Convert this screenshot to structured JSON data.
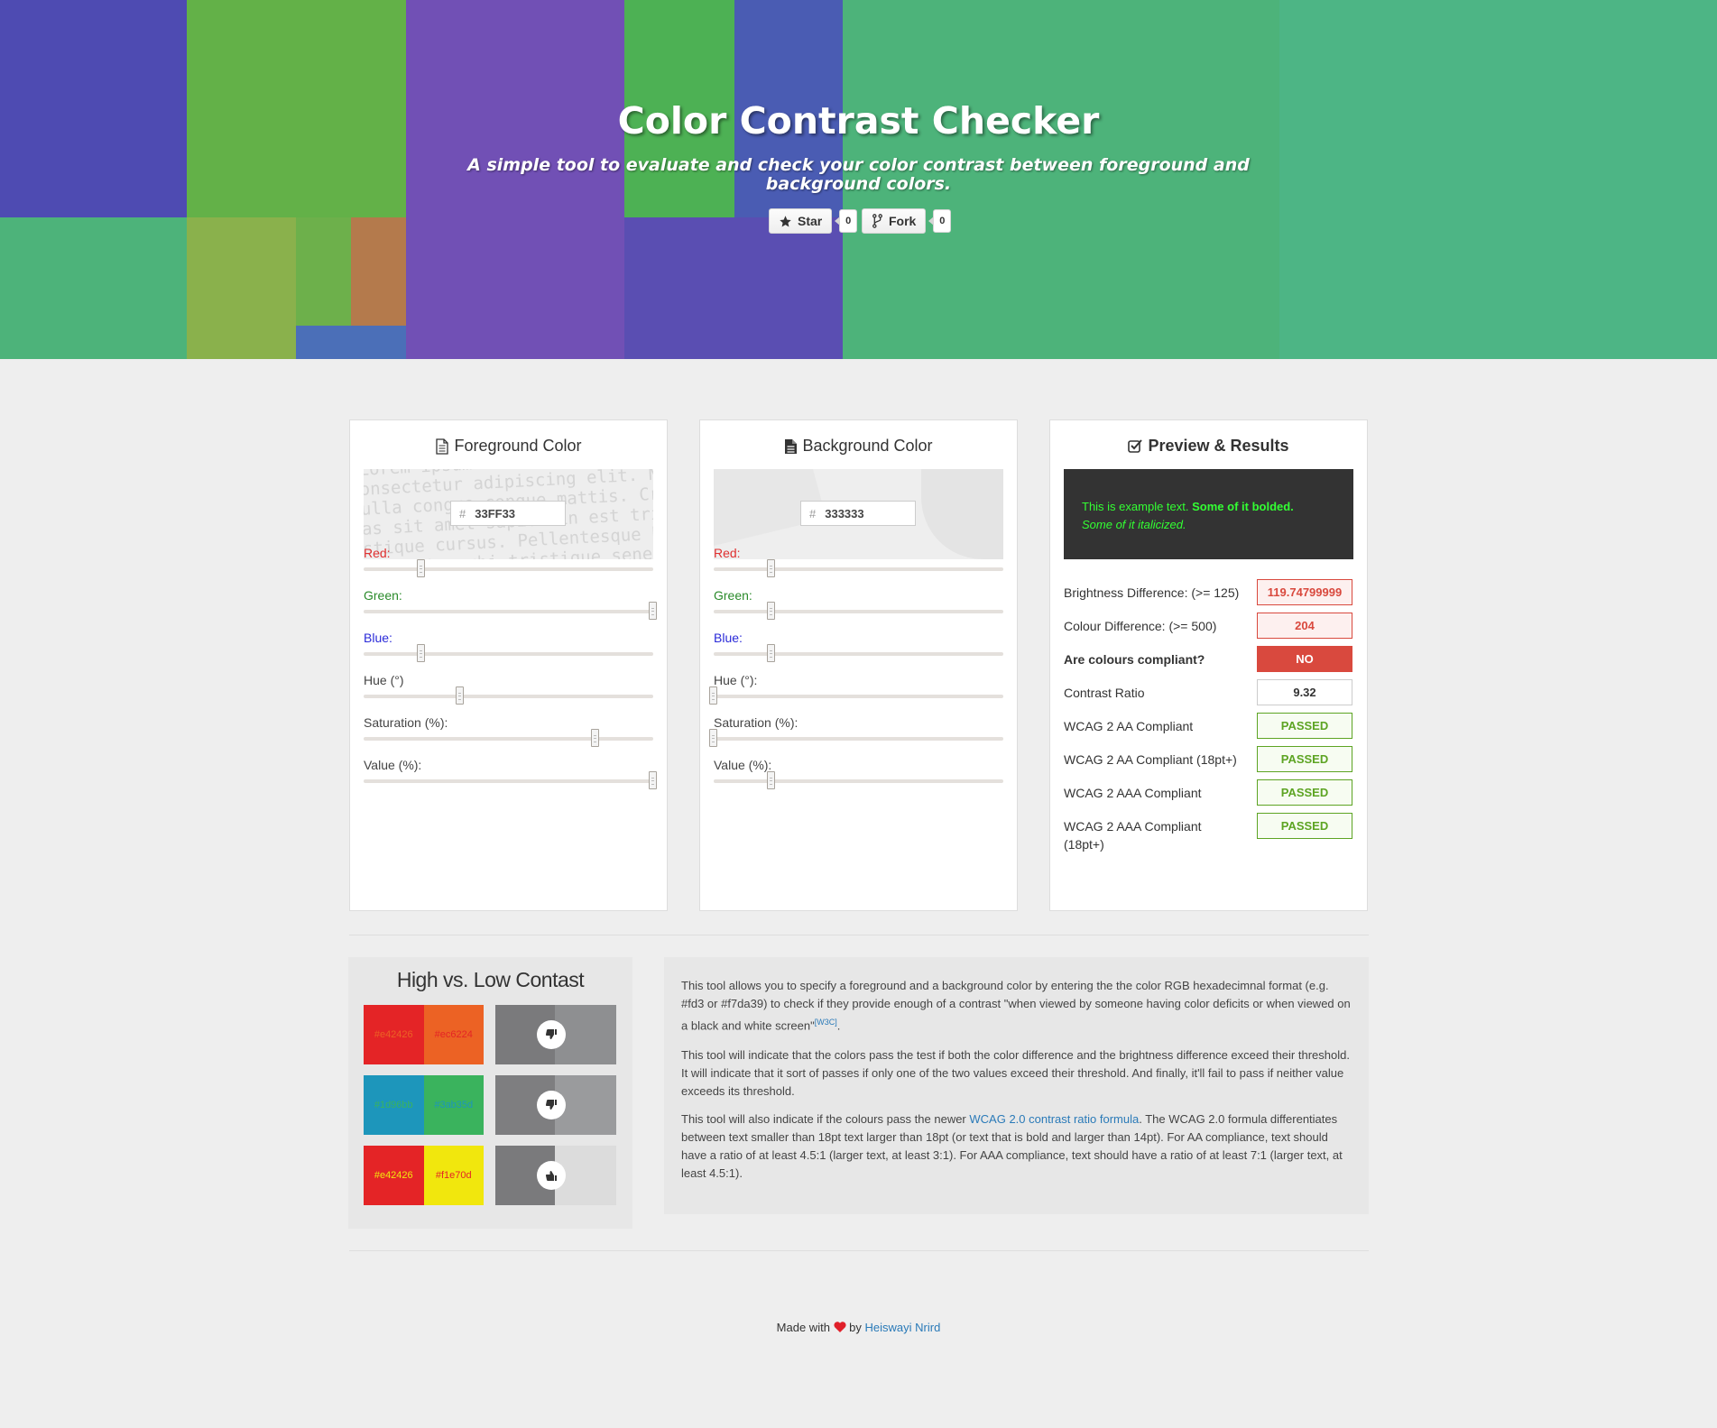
{
  "hero": {
    "title": "Color Contrast Checker",
    "subtitle": "A simple tool to evaluate and check your color contrast between foreground and background colors.",
    "star_label": "Star",
    "star_count": "0",
    "fork_label": "Fork",
    "fork_count": "0"
  },
  "foreground": {
    "title": "Foreground Color",
    "icon": "file-text-outline-icon",
    "hex": "33FF33",
    "sliders": [
      {
        "label": "Red:",
        "value": 51,
        "max": 255,
        "color": "#e03030"
      },
      {
        "label": "Green:",
        "value": 255,
        "max": 255,
        "color": "#2a8a2a"
      },
      {
        "label": "Blue:",
        "value": 51,
        "max": 255,
        "color": "#2a2ad8"
      },
      {
        "label": "Hue (°)",
        "value": 120,
        "max": 360,
        "color": "#444444"
      },
      {
        "label": "Saturation (%):",
        "value": 80,
        "max": 100,
        "color": "#444444"
      },
      {
        "label": "Value (%):",
        "value": 100,
        "max": 100,
        "color": "#444444"
      }
    ]
  },
  "background": {
    "title": "Background Color",
    "icon": "file-text-solid-icon",
    "hex": "333333",
    "sliders": [
      {
        "label": "Red:",
        "value": 51,
        "max": 255,
        "color": "#e03030"
      },
      {
        "label": "Green:",
        "value": 51,
        "max": 255,
        "color": "#2a8a2a"
      },
      {
        "label": "Blue:",
        "value": 51,
        "max": 255,
        "color": "#2a2ad8"
      },
      {
        "label": "Hue (°):",
        "value": 0,
        "max": 360,
        "color": "#444444"
      },
      {
        "label": "Saturation (%):",
        "value": 0,
        "max": 100,
        "color": "#444444"
      },
      {
        "label": "Value (%):",
        "value": 20,
        "max": 100,
        "color": "#444444"
      }
    ]
  },
  "preview": {
    "title": "Preview & Results",
    "icon": "check-square-icon",
    "sample_text": "This is example text.",
    "sample_bold": "Some of it bolded.",
    "sample_italic": "Some of it italicized.",
    "results": [
      {
        "label": "Brightness Difference: (>= 125)",
        "value": "119.74799999",
        "status": "fail"
      },
      {
        "label": "Colour Difference: (>= 500)",
        "value": "204",
        "status": "fail"
      },
      {
        "label": "Are colours compliant?",
        "value": "NO",
        "status": "no"
      },
      {
        "label": "Contrast Ratio",
        "value": "9.32",
        "status": "neutral"
      },
      {
        "label": "WCAG 2 AA Compliant",
        "value": "PASSED",
        "status": "pass"
      },
      {
        "label": "WCAG 2 AA Compliant (18pt+)",
        "value": "PASSED",
        "status": "pass"
      },
      {
        "label": "WCAG 2 AAA Compliant",
        "value": "PASSED",
        "status": "pass"
      },
      {
        "label": "WCAG 2 AAA Compliant (18pt+)",
        "value": "PASSED",
        "status": "pass"
      }
    ]
  },
  "hilo": {
    "title": "High vs. Low Contast",
    "pairs": [
      {
        "a": "#e42426",
        "b": "#ec6224",
        "gray_left": "#7a7a7c",
        "gray_right": "#8e8f91",
        "icon": "thumbs-down-icon"
      },
      {
        "a": "#1d96bb",
        "b": "#3ab35d",
        "gray_left": "#7e7e80",
        "gray_right": "#9a9b9d",
        "icon": "thumbs-down-icon"
      },
      {
        "a": "#e42426",
        "b": "#f1e70d",
        "gray_left": "#7a7a7c",
        "gray_right": "#dcdcdc",
        "icon": "thumbs-up-icon"
      }
    ]
  },
  "info": {
    "p1_text": "This tool allows you to specify a foreground and a background color by entering the the color RGB hexadecimnal format (e.g. #fd3 or #f7da39) to check if they provide enough of a contrast \"when viewed by someone having color deficits or when viewed on a black and white screen\"",
    "p1_link": "[W3C]",
    "p1_end": ".",
    "p2": "This tool will indicate that the colors pass the test if both the color difference and the brightness difference exceed their threshold. It will indicate that it sort of passes if only one of the two values exceed their threshold. And finally, it'll fail to pass if neither value exceeds its threshold.",
    "p3_start": "This tool will also indicate if the colours pass the newer ",
    "p3_link": "WCAG 2.0 contrast ratio formula",
    "p3_end": ". The WCAG 2.0 formula differentiates between text smaller than 18pt text larger than 18pt (or text that is bold and larger than 14pt). For AA compliance, text should have a ratio of at least 4.5:1 (larger text, at least 3:1). For AAA compliance, text should have a ratio of at least 7:1 (larger text, at least 4.5:1)."
  },
  "footer": {
    "made_with": "Made with",
    "by": "by",
    "author": "Heiswayi Nrird"
  },
  "colors": {
    "fg": "#33FF33",
    "bg": "#333333",
    "fail": "#d9493e",
    "pass": "#5da423",
    "heart": "#e0202a"
  },
  "lorem": "Lorem ipsum dolor sit amet, consectetur adipiscing elit. Nulla congue congue mattis. Cras sit amet sapien in est tristique cursus. Pellentesque habitant morbi tristique senectus et netus. In nec nisl leifend. Donec euismod ligula ac quam. Nec sed leo."
}
